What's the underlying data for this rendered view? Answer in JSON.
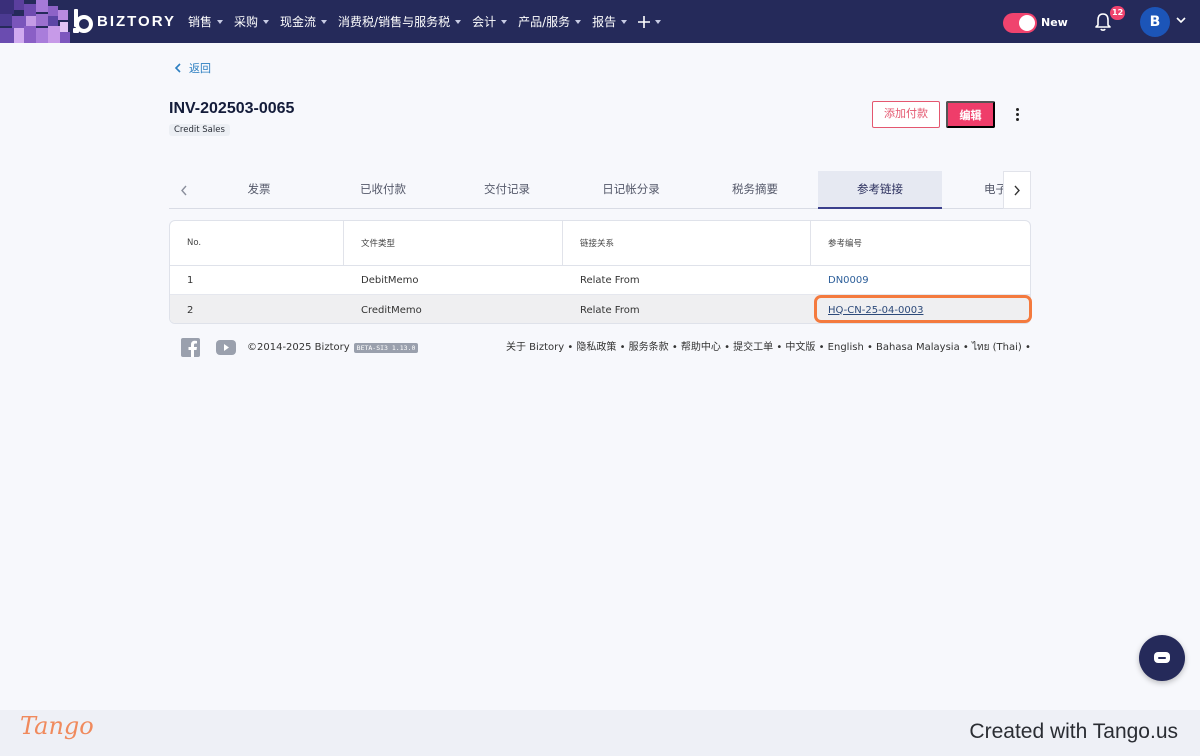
{
  "nav": {
    "brand": "BIZTORY",
    "menu": [
      {
        "label": "销售",
        "has_caret": true
      },
      {
        "label": "采购",
        "has_caret": true
      },
      {
        "label": "现金流",
        "has_caret": true
      },
      {
        "label": "消费税/销售与服务税",
        "has_caret": true
      },
      {
        "label": "会计",
        "has_caret": true
      },
      {
        "label": "产品/服务",
        "has_caret": true
      },
      {
        "label": "报告",
        "has_caret": true
      }
    ],
    "plus_icon": "plus-icon",
    "toggle_label": "New",
    "notifications_count": "12",
    "avatar_initial": "B"
  },
  "page": {
    "back_label": "返回",
    "title": "INV-202503-0065",
    "tag": "Credit Sales",
    "add_payment_label": "添加付款",
    "edit_label": "编辑"
  },
  "tabs": [
    {
      "label": "发票",
      "active": false
    },
    {
      "label": "已收付款",
      "active": false
    },
    {
      "label": "交付记录",
      "active": false
    },
    {
      "label": "日记帐分录",
      "active": false
    },
    {
      "label": "税务摘要",
      "active": false
    },
    {
      "label": "参考链接",
      "active": true
    },
    {
      "label": "电子",
      "active": false
    }
  ],
  "table": {
    "headers": [
      "No.",
      "文件类型",
      "链接关系",
      "参考编号"
    ],
    "rows": [
      {
        "no": "1",
        "doc_type": "DebitMemo",
        "relation": "Relate From",
        "ref": "DN0009"
      },
      {
        "no": "2",
        "doc_type": "CreditMemo",
        "relation": "Relate From",
        "ref": "HQ-CN-25-04-0003"
      }
    ]
  },
  "footer": {
    "copyright": "©2014-2025 Biztory",
    "version": "BETA-SI3 1.13.0",
    "links": "关于 Biztory • 隐私政策 • 服务条款 • 帮助中心 • 提交工单 • 中文版 • English • Bahasa Malaysia • ไทย (Thai) •"
  },
  "tango": {
    "logo": "Tango",
    "credit": "Created with Tango.us"
  },
  "colors": {
    "nav_bg": "#252a5a",
    "accent_pink": "#ef3d6a",
    "highlight_orange": "#f47a3e",
    "link_blue": "#2d7fc1"
  }
}
